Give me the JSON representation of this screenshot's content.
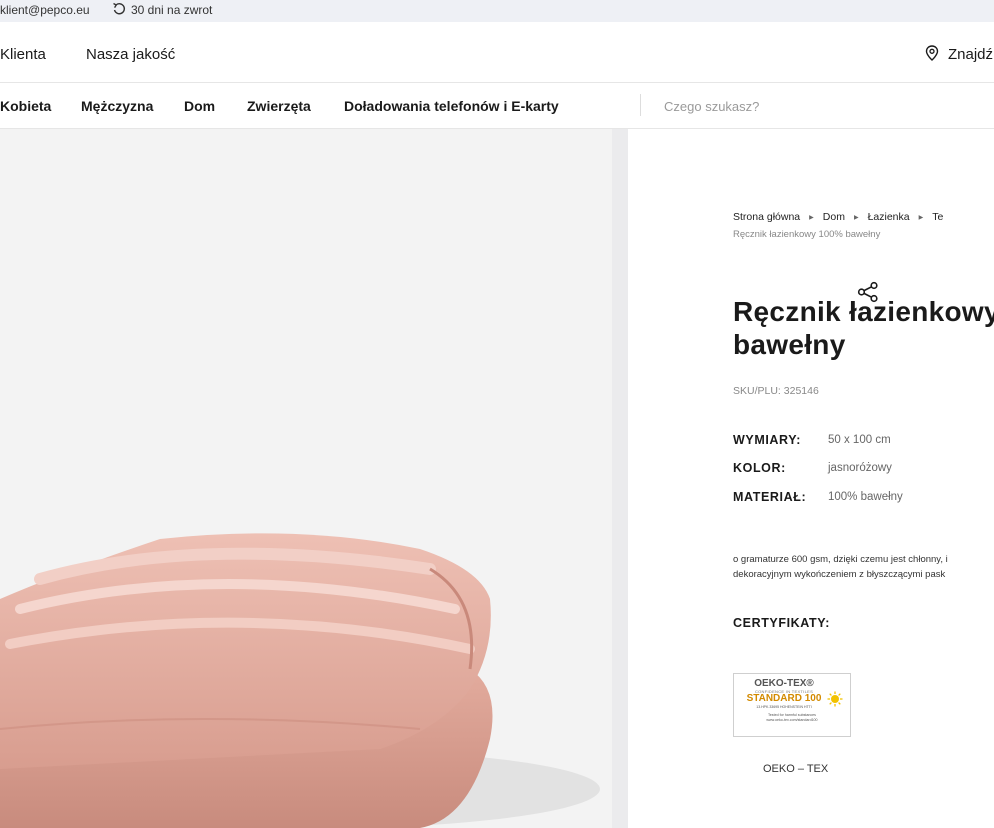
{
  "topbar": {
    "email": "klient@pepco.eu",
    "returns": "30 dni na zwrot"
  },
  "header": {
    "link_client": "Klienta",
    "link_quality": "Nasza jakość",
    "find_store": "Znajdź"
  },
  "categories": [
    "Kobieta",
    "Mężczyzna",
    "Dom",
    "Zwierzęta",
    "Doładowania telefonów i E-karty"
  ],
  "search": {
    "placeholder": "Czego szukasz?"
  },
  "breadcrumb": {
    "items": [
      "Strona główna",
      "Dom",
      "Łazienka",
      "Te"
    ],
    "current": "Ręcznik łazienkowy 100% bawełny"
  },
  "product": {
    "title_line1": "Ręcznik łazienkowy",
    "title_line2": "bawełny",
    "sku": "SKU/PLU: 325146",
    "attributes": [
      {
        "key": "WYMIARY:",
        "value": "50 x 100 cm"
      },
      {
        "key": "KOLOR:",
        "value": "jasnoróżowy"
      },
      {
        "key": "MATERIAŁ:",
        "value": "100% bawełny"
      }
    ],
    "description_line1": "o gramaturze 600 gsm, dzięki czemu jest chłonny, i",
    "description_line2": "dekoracyjnym wykończeniem z błyszczącymi pask"
  },
  "certificates": {
    "heading": "CERTYFIKATY:",
    "badge_brand": "OEKO-TEX®",
    "badge_confidence": "CONFIDENCE IN TEXTILES",
    "badge_standard": "STANDARD 100",
    "badge_code": "13.HPK.33695 HOHENSTEIN HTTI",
    "badge_tested_1": "Tested for harmful substances",
    "badge_tested_2": "www.oeko-tex.com/standard100",
    "label": "OEKO – TEX"
  },
  "colors": {
    "towel": "#e3ada0",
    "image_bg": "#f3f3f3",
    "standard_orange": "#d38a00"
  }
}
